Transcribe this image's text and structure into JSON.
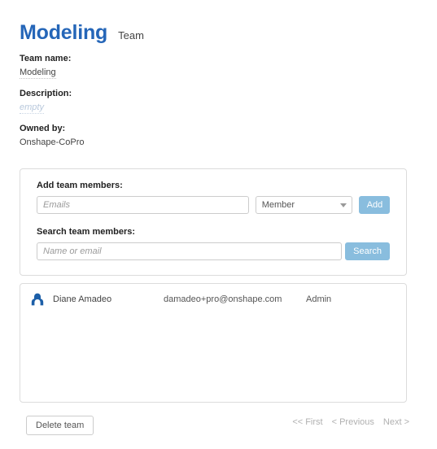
{
  "header": {
    "title": "Modeling",
    "subtitle": "Team"
  },
  "details": {
    "team_name_label": "Team name:",
    "team_name_value": "Modeling",
    "description_label": "Description:",
    "description_value": "empty",
    "owned_by_label": "Owned by:",
    "owned_by_value": "Onshape-CoPro"
  },
  "form": {
    "add_members_label": "Add team members:",
    "emails_placeholder": "Emails",
    "emails_value": "",
    "role_selected": "Member",
    "role_options": [
      "Member"
    ],
    "add_button_label": "Add",
    "search_members_label": "Search team members:",
    "search_placeholder": "Name or email",
    "search_value": "",
    "search_button_label": "Search"
  },
  "members": {
    "rows": [
      {
        "avatar": "person-avatar-icon",
        "name": "Diane Amadeo",
        "email": "damadeo+pro@onshape.com",
        "role": "Admin"
      }
    ]
  },
  "footer": {
    "delete_button_label": "Delete team",
    "pagination": {
      "first": "<< First",
      "previous": "< Previous",
      "next": "Next >"
    }
  },
  "colors": {
    "title_blue": "#2566b8",
    "button_blue": "#89bdde",
    "avatar_blue": "#1d5fa8",
    "muted_text": "#b0b0b0",
    "panel_border": "#dcdcdc"
  }
}
